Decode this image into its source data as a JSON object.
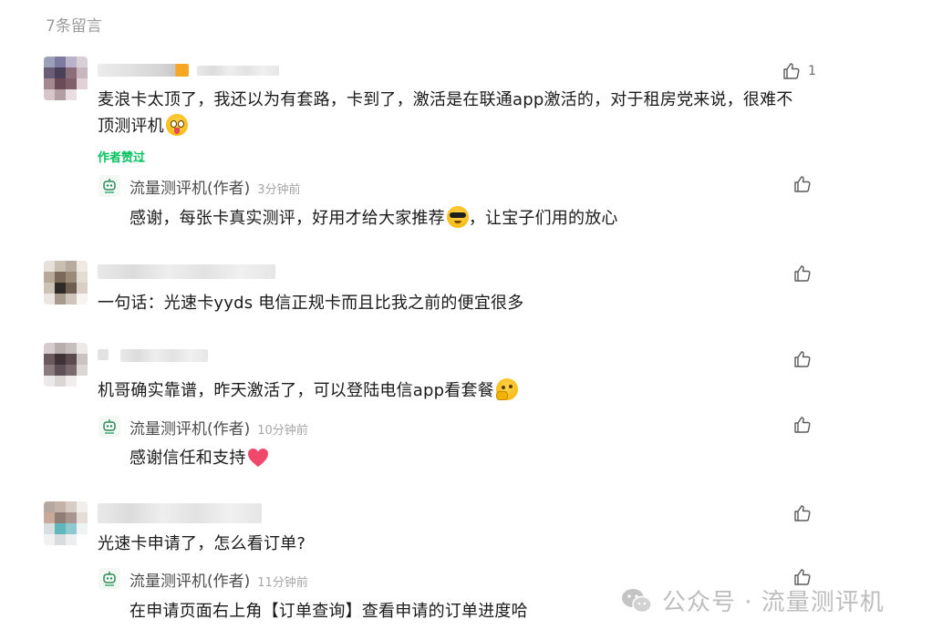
{
  "header": {
    "count_label": "7条留言"
  },
  "comments": [
    {
      "text_line1": "麦浪卡太顶了，我还以为有套路，卡到了，激活是在联通app激活的，对于租房党来说，很难不",
      "text_line2": "顶测评机",
      "emoji": "tongue-emoji",
      "like_count": "1",
      "liked_tag": "作者赞过",
      "reply": {
        "author": "流量测评机(作者)",
        "time": "3分钟前",
        "text": "感谢，每张卡真实测评，好用才给大家推荐",
        "emoji": "sunglasses-emoji",
        "text_after": "，让宝子们用的放心"
      }
    },
    {
      "text": "一句话：光速卡yyds 电信正规卡而且比我之前的便宜很多"
    },
    {
      "text": "机哥确实靠谱，昨天激活了，可以登陆电信app看套餐",
      "emoji": "thinking-emoji",
      "reply": {
        "author": "流量测评机(作者)",
        "time": "10分钟前",
        "text": "感谢信任和支持",
        "emoji": "heart-emoji"
      }
    },
    {
      "text": "光速卡申请了，怎么看订单?",
      "reply": {
        "author": "流量测评机(作者)",
        "time": "11分钟前",
        "text": "在申请页面右上角【订单查询】查看申请的订单进度哈"
      }
    }
  ],
  "watermark": {
    "text": "公众号 · 流量测评机"
  },
  "colors": {
    "liked_tag": "#07c160",
    "muted": "#9a9a9a",
    "heart": "#f0486b"
  }
}
